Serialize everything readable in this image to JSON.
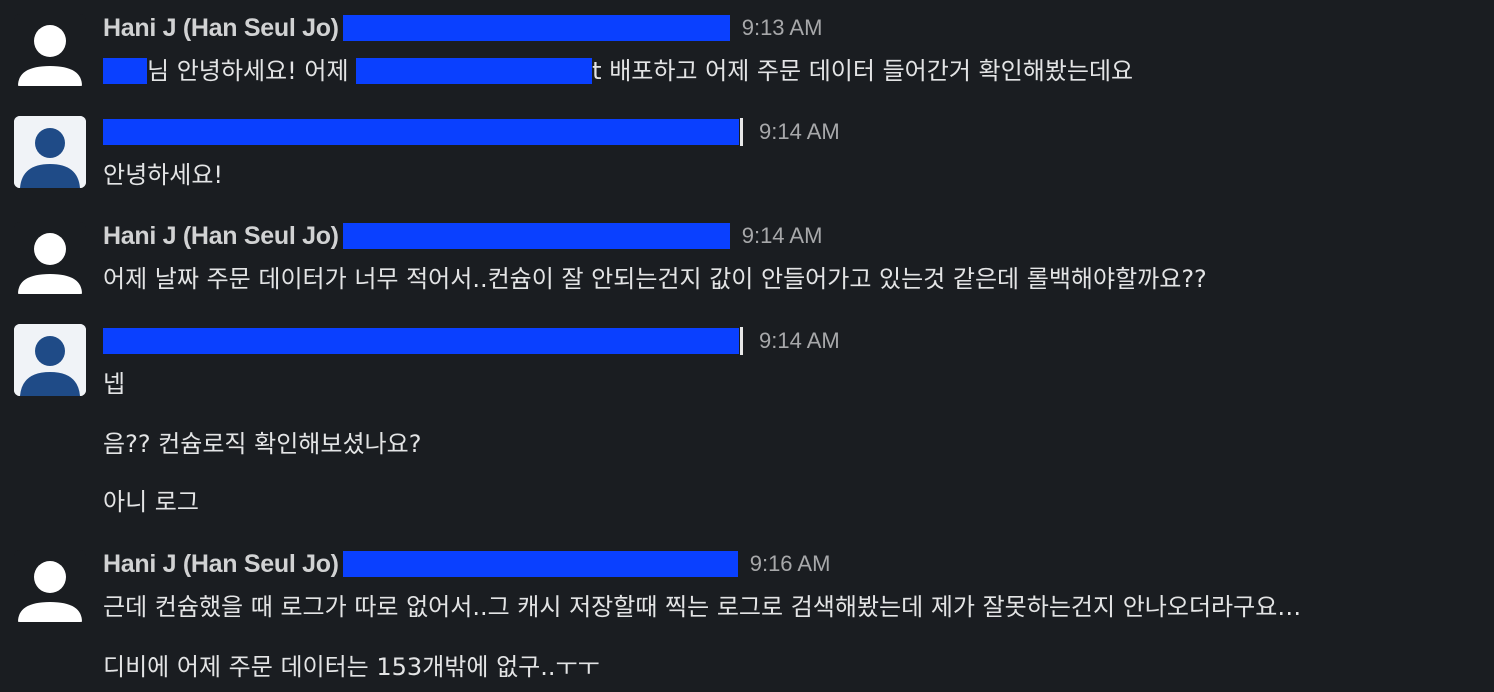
{
  "messages": [
    {
      "sender": "Hani J (Han Seul Jo)",
      "time": "9:13 AM",
      "lines": [
        {
          "pre": "",
          "mid": "님 안녕하세요! 어제 ",
          "post": "t 배포하고 어제 주문 데이터 들어간거 확인해봤는데요"
        }
      ]
    },
    {
      "sender": "",
      "time": "9:14 AM",
      "lines": [
        "안녕하세요!"
      ]
    },
    {
      "sender": "Hani J (Han Seul Jo)",
      "time": "9:14 AM",
      "lines": [
        "어제 날짜 주문 데이터가 너무 적어서..컨슘이 잘 안되는건지 값이 안들어가고 있는것 같은데 롤백해야할까요??"
      ]
    },
    {
      "sender": "",
      "time": "9:14 AM",
      "lines": [
        "넵",
        "음?? 컨슘로직 확인해보셨나요?",
        "아니 로그"
      ]
    },
    {
      "sender": "Hani J (Han Seul Jo)",
      "time": "9:16 AM",
      "lines": [
        "근데 컨슘했을 때 로그가 따로 없어서..그 캐시 저장할때 찍는 로그로 검색해봤는데 제가 잘못하는건지 안나오더라구요…",
        "디비에 어제 주문 데이터는 153개밖에 없구..ㅜㅜ"
      ]
    }
  ]
}
